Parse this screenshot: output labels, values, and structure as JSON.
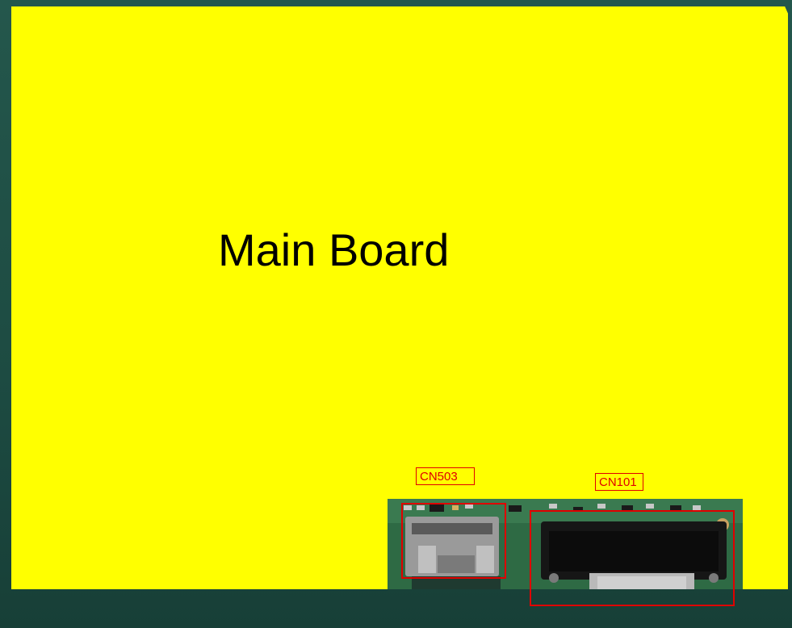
{
  "diagram": {
    "title": "Main Board",
    "connectors": [
      {
        "id": "CN503",
        "label": "CN503"
      },
      {
        "id": "CN101",
        "label": "CN101"
      }
    ],
    "colors": {
      "board": "#ffff00",
      "highlight": "#e00000",
      "background": "#1b4a41",
      "pcb": "#2f6a45"
    }
  }
}
